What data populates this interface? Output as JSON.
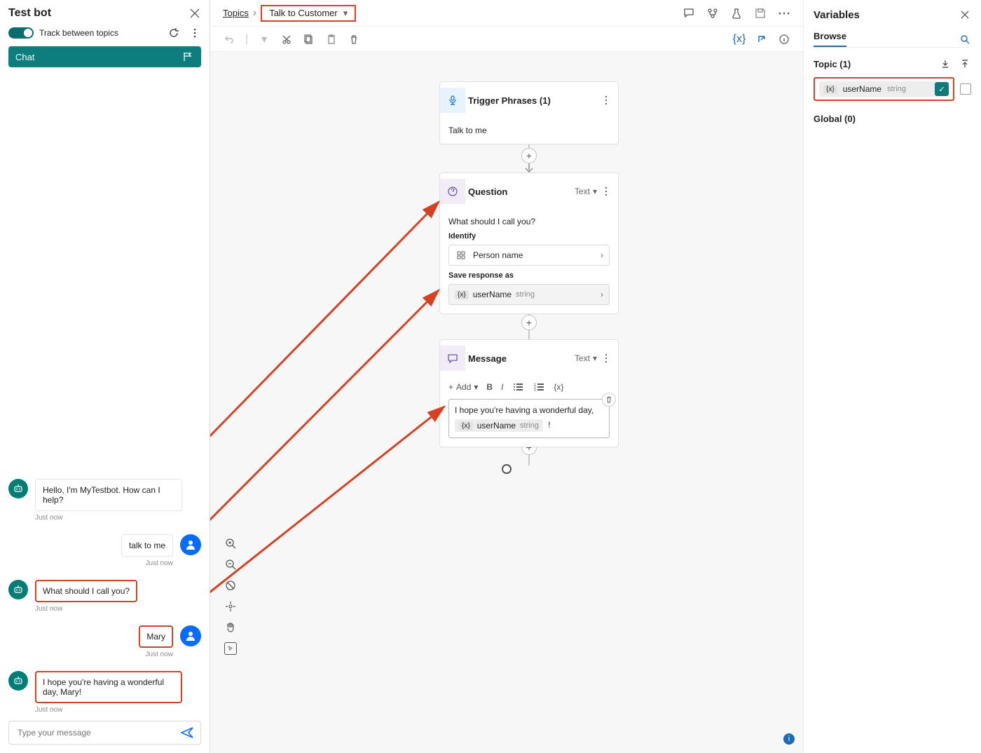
{
  "test_panel": {
    "title": "Test bot",
    "track_label": "Track between topics",
    "chat_tab": "Chat",
    "messages": [
      {
        "who": "bot",
        "text": "Hello, I'm MyTestbot. How can I help?",
        "ts": "Just now"
      },
      {
        "who": "user",
        "text": "talk to me",
        "ts": "Just now"
      },
      {
        "who": "bot",
        "text": "What should I call you?",
        "ts": "Just now",
        "hl": true
      },
      {
        "who": "user",
        "text": "Mary",
        "ts": "Just now",
        "hl": true
      },
      {
        "who": "bot",
        "text": "I hope you're having a wonderful day, Mary!",
        "ts": "Just now",
        "hl": true
      }
    ],
    "input_placeholder": "Type your message"
  },
  "breadcrumb": {
    "root": "Topics",
    "current": "Talk to Customer"
  },
  "nodes": {
    "trigger_title": "Trigger Phrases (1)",
    "trigger_body": "Talk to me",
    "question_title": "Question",
    "question_type": "Text",
    "question_prompt": "What should I call you?",
    "identify_label": "Identify",
    "identify_value": "Person name",
    "save_label": "Save response as",
    "var_name": "userName",
    "var_type": "string",
    "message_title": "Message",
    "message_type": "Text",
    "add_label": "Add",
    "message_text": "I hope you're having a wonderful day,",
    "message_tail": "!"
  },
  "variables": {
    "title": "Variables",
    "tab": "Browse",
    "topic_label": "Topic (1)",
    "global_label": "Global (0)",
    "var_name": "userName",
    "var_type": "string"
  }
}
